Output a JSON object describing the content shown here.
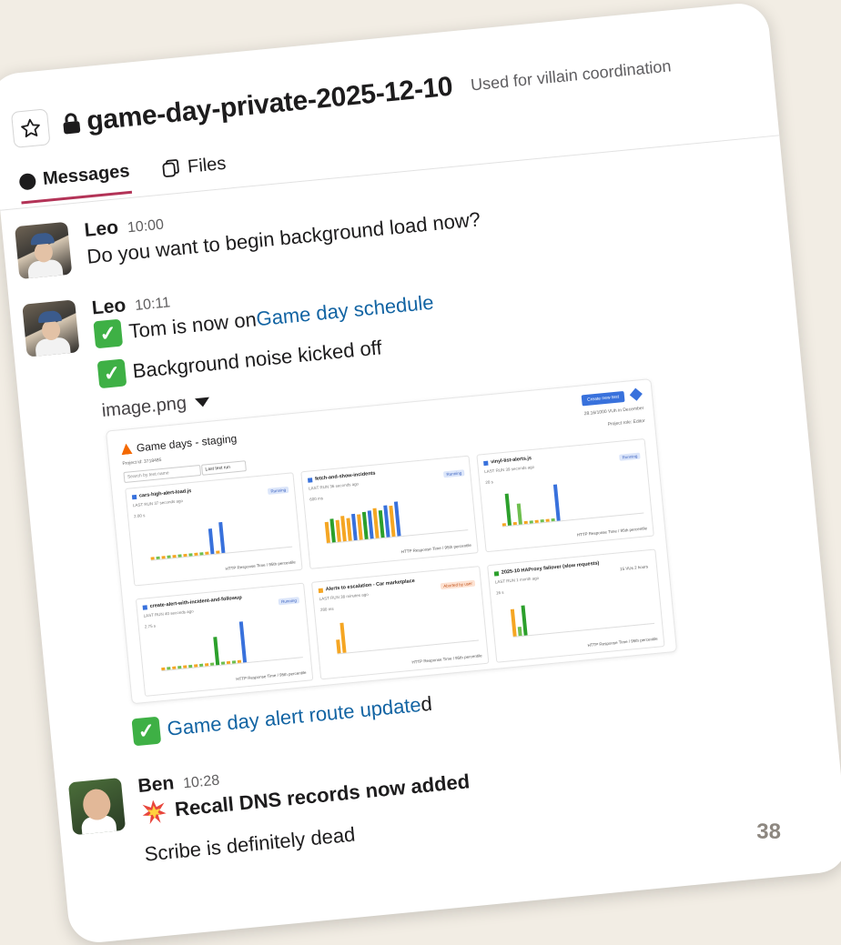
{
  "channel": {
    "name": "game-day-private-2025-12-10",
    "topic": "Used for villain coordination"
  },
  "tabs": [
    {
      "label": "Messages",
      "active": true
    },
    {
      "label": "Files",
      "active": false
    }
  ],
  "messages": [
    {
      "author": "Leo",
      "time": "10:00",
      "text": "Do you want to begin background load now?"
    },
    {
      "author": "Leo",
      "time": "10:11",
      "line1_prefix": "Tom is now on ",
      "line1_link": "Game day schedule",
      "line2": "Background noise kicked off",
      "file_name": "image.png",
      "line3_link": "Game day alert route update",
      "line3_suffix": "d"
    },
    {
      "author": "Ben",
      "time": "10:28",
      "headline": "Recall DNS records now added",
      "text": "Scribe is definitely dead"
    }
  ],
  "screenshot": {
    "title": "Game days - staging",
    "project_id": "Project id: 3718485",
    "search_placeholder": "Search by test name",
    "sort": "Last test run",
    "create_button": "Create new test",
    "vuh": "28.16/1000 VUh in December",
    "role": "Project role: Editor",
    "footer": "HTTP Response Time / 95th percentile",
    "panels": [
      {
        "name": "cars-high-alert-load.js",
        "last_run": "LAST RUN 37 seconds ago",
        "status": "Running",
        "status_color": "#3b62c0",
        "dot": "#3871dc",
        "ymax": "2.00 s",
        "bars": [
          0.05,
          0.05,
          0.05,
          0.05,
          0.05,
          0.05,
          0.05,
          0.05,
          0.05,
          0.05,
          0.05,
          0.55,
          0.05,
          0.68
        ]
      },
      {
        "name": "fetch-and-show-incidents",
        "last_run": "LAST RUN 36 seconds ago",
        "status": "Running",
        "status_color": "#3b62c0",
        "dot": "#3871dc",
        "ymax": "600 ms",
        "bars": [
          0.45,
          0.52,
          0.48,
          0.55,
          0.5,
          0.58,
          0.56,
          0.6,
          0.62,
          0.65,
          0.6,
          0.7,
          0.68,
          0.75
        ]
      },
      {
        "name": "vinyl-list-alerts.js",
        "last_run": "LAST RUN 39 seconds ago",
        "status": "Running",
        "status_color": "#3b62c0",
        "dot": "#3871dc",
        "ymax": "20 s",
        "bars": [
          0.05,
          0.7,
          0.05,
          0.45,
          0.05,
          0.05,
          0.05,
          0.05,
          0.05,
          0.05,
          0.8
        ]
      },
      {
        "name": "create-alert-with-incident-and-followup",
        "last_run": "LAST RUN 40 seconds ago",
        "status": "Running",
        "status_color": "#3b62c0",
        "dot": "#3871dc",
        "ymax": "2.75 s",
        "bars": [
          0.05,
          0.05,
          0.05,
          0.05,
          0.05,
          0.05,
          0.05,
          0.05,
          0.05,
          0.05,
          0.62,
          0.05,
          0.05,
          0.05,
          0.05,
          0.9
        ]
      },
      {
        "name": "Alerts to escalation - Car marketplace",
        "last_run": "LAST RUN 38 minutes ago",
        "status": "Aborted by user",
        "status_color": "#c2531b",
        "dot": "#f5a623",
        "ymax": "280 ms",
        "bars": [
          0.3,
          0.65
        ]
      },
      {
        "name": "2025-10 HAProxy failover (slow requests)",
        "last_run": "LAST RUN 1 month ago",
        "status": "15 VUs 2 hours",
        "status_color": "#555555",
        "dot": "#2ca02c",
        "ymax": "16 s",
        "bars": [
          0.6,
          0.2,
          0.65
        ]
      }
    ]
  },
  "page_number": "38"
}
